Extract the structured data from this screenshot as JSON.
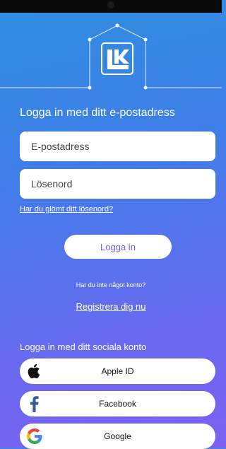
{
  "brand": {
    "logo_text": "LK"
  },
  "login": {
    "title": "Logga in med ditt e-postadress",
    "email_placeholder": "E-postadress",
    "password_placeholder": "Lösenord",
    "forgot_link": "Har du glömt ditt lösenord?",
    "login_button": "Logga in"
  },
  "register": {
    "no_account_text": "Har du inte något konto?",
    "register_link": "Registrera dig nu"
  },
  "social": {
    "title": "Logga in med ditt sociala konto",
    "buttons": [
      {
        "label": "Apple ID",
        "icon": "apple-icon"
      },
      {
        "label": "Facebook",
        "icon": "facebook-icon"
      },
      {
        "label": "Google",
        "icon": "google-icon"
      }
    ]
  },
  "colors": {
    "gradient_top": "#2f8fe0",
    "gradient_bottom": "#7c61f3",
    "button_text": "#6a5ef0",
    "facebook": "#1877f2"
  }
}
